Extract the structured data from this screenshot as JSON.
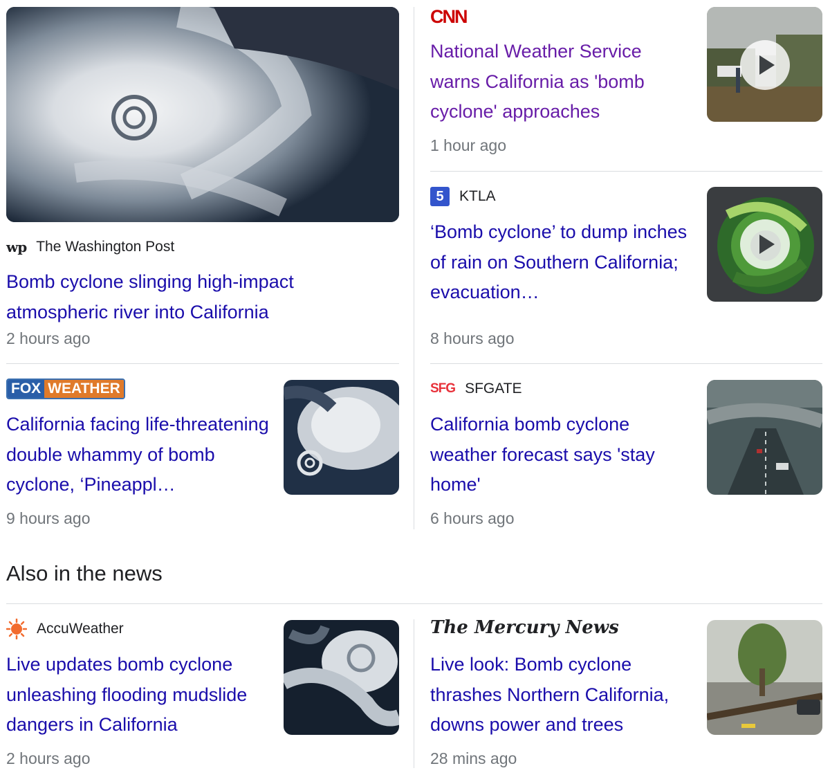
{
  "top_stories": [
    {
      "source": "The Washington Post",
      "source_logo": "wp",
      "headline": "Bomb cyclone slinging high-impact atmospheric river into California",
      "time": "2 hours ago",
      "image": "satellite-cyclone-image"
    },
    {
      "source": "CNN",
      "source_logo": "CNN",
      "headline": "National Weather Service warns California as 'bomb cyclone' approaches",
      "time": "1 hour ago",
      "image": "video-thumbnail-street",
      "has_video": true
    },
    {
      "source": "KTLA",
      "source_logo": "5",
      "headline": "‘Bomb cyclone’ to dump inches of rain on Southern California; evacuation…",
      "time": "8 hours ago",
      "image": "video-thumbnail-radar",
      "has_video": true
    },
    {
      "source": "FOX WEATHER",
      "source_logo_parts": [
        "FOX",
        "WEATHER"
      ],
      "headline": "California facing life-threatening double whammy of bomb cyclone, ‘Pineappl…",
      "time": "9 hours ago",
      "image": "satellite-cyclone-image"
    },
    {
      "source": "SFGATE",
      "source_logo": "SFG",
      "headline": "California bomb cyclone weather forecast says 'stay home'",
      "time": "6 hours ago",
      "image": "highway-rain-image"
    }
  ],
  "also_in_news": {
    "title": "Also in the news",
    "items": [
      {
        "source": "AccuWeather",
        "source_logo": "sun-icon",
        "headline": "Live updates bomb cyclone unleashing flooding mudslide dangers in California",
        "time": "2 hours ago",
        "image": "satellite-cyclone-image"
      },
      {
        "source": "The Mercury News",
        "source_logo": "The Mercury News",
        "headline": "Live look: Bomb cyclone thrashes Northern California, downs power and trees",
        "time": "28 mins ago",
        "image": "fallen-tree-image"
      }
    ]
  },
  "colors": {
    "link": "#1a0dab",
    "visited_link": "#681da8",
    "meta": "#70757a",
    "divider": "#dadce0"
  }
}
